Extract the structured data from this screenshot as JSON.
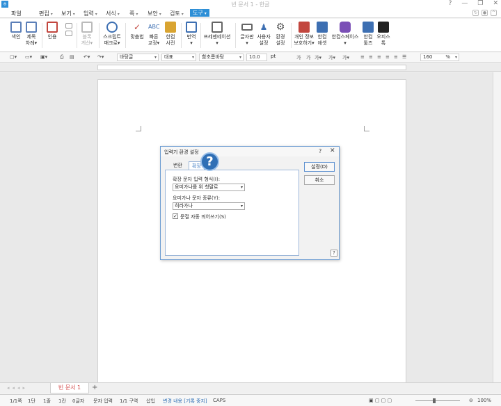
{
  "app": {
    "title": "빈 문서 1 - 한글",
    "icon_letter": "ㅎ"
  },
  "window_controls": {
    "help": "?",
    "minimize": "—",
    "restore": "❐",
    "close": "✕"
  },
  "menu": {
    "items": [
      {
        "label": "파일",
        "name": "menu-file"
      },
      {
        "label": "편집",
        "name": "menu-edit"
      },
      {
        "label": "보기",
        "name": "menu-view"
      },
      {
        "label": "입력",
        "name": "menu-insert"
      },
      {
        "label": "서식",
        "name": "menu-format"
      },
      {
        "label": "쪽",
        "name": "menu-page"
      },
      {
        "label": "보안",
        "name": "menu-security"
      },
      {
        "label": "검토",
        "name": "menu-review"
      },
      {
        "label": "도구",
        "name": "menu-tools"
      }
    ],
    "active": "도구"
  },
  "ribbon": {
    "buttons": [
      {
        "label": "색인",
        "icon": "index-icon",
        "color": "#5b7fb8"
      },
      {
        "label": "제목\n차례▾",
        "icon": "toc-icon",
        "color": "#5b7fb8"
      },
      {
        "label": "인용",
        "icon": "citation-icon",
        "color": "#c2463e"
      },
      {
        "label": "블록\n계산▾",
        "icon": "block-calc-icon",
        "color": "#bbbbbb"
      },
      {
        "label": "스크립트\n매크로▾",
        "icon": "macro-icon",
        "color": "#3d6fb2"
      },
      {
        "label": "맞춤법",
        "icon": "spellcheck-icon",
        "color": "#c2463e"
      },
      {
        "label": "빠른\n교정▾",
        "icon": "quick-correct-icon",
        "color": "#3d6fb2"
      },
      {
        "label": "한컴\n사전",
        "icon": "dictionary-icon",
        "color": "#d9a431"
      },
      {
        "label": "번역\n▾",
        "icon": "translate-icon",
        "color": "#3d6fb2"
      },
      {
        "label": "프레젠테이션\n▾",
        "icon": "presentation-icon",
        "color": "#666666"
      },
      {
        "label": "글자판\n▾",
        "icon": "keyboard-icon",
        "color": "#666666"
      },
      {
        "label": "사용자\n설정",
        "icon": "user-settings-icon",
        "color": "#3d6fb2"
      },
      {
        "label": "환경\n설정",
        "icon": "gear-icon",
        "color": "#555555"
      },
      {
        "label": "개인 정보\n보호하기▾",
        "icon": "privacy-icon",
        "color": "#c2463e"
      },
      {
        "label": "한컴\n애셋",
        "icon": "asset-icon",
        "color": "#3d6fb2"
      },
      {
        "label": "한컴스페이스\n▾",
        "icon": "hancom-space-icon",
        "color": "#7a4fb6"
      },
      {
        "label": "한컴\n툴즈",
        "icon": "tools-icon",
        "color": "#3d6fb2"
      },
      {
        "label": "오피스\n톡",
        "icon": "office-talk-icon",
        "color": "#222222"
      }
    ]
  },
  "format_toolbar": {
    "style": "바탕글",
    "language": "대표",
    "font": "함초롬바탕",
    "font_size": "10.0",
    "size_unit": "pt",
    "zoom": "160",
    "zoom_unit": "%"
  },
  "dialog": {
    "title": "입력기 환경 설정",
    "help": "?",
    "close": "✕",
    "tabs": [
      {
        "label": "변환",
        "selected": false
      },
      {
        "label": "확장",
        "selected": true
      }
    ],
    "field1_label": "확장 문자 입력 형식(I):",
    "field1_value": "요미가나를 위 첫말로",
    "field2_label": "요미가나 문자 종류(Y):",
    "field2_value": "히라가나",
    "checkbox_label": "문절 자동 띄어쓰기(S)",
    "checkbox_checked": true,
    "ok_button": "설정(D)",
    "cancel_button": "취소",
    "help_button": "?",
    "overlay_icon": "?"
  },
  "doc_tabs": {
    "active_tab": "빈 문서 1",
    "add": "+"
  },
  "status": {
    "page": "1/1쪽",
    "section": "1단",
    "line": "1줄",
    "column": "1칸",
    "chars": "0글자",
    "input_mode": "문자 입력",
    "section_count": "1/1 구역",
    "insert_mode": "삽입",
    "track_changes": "변경 내용 [기록 중지]",
    "caps": "CAPS",
    "zoom": "100%"
  }
}
